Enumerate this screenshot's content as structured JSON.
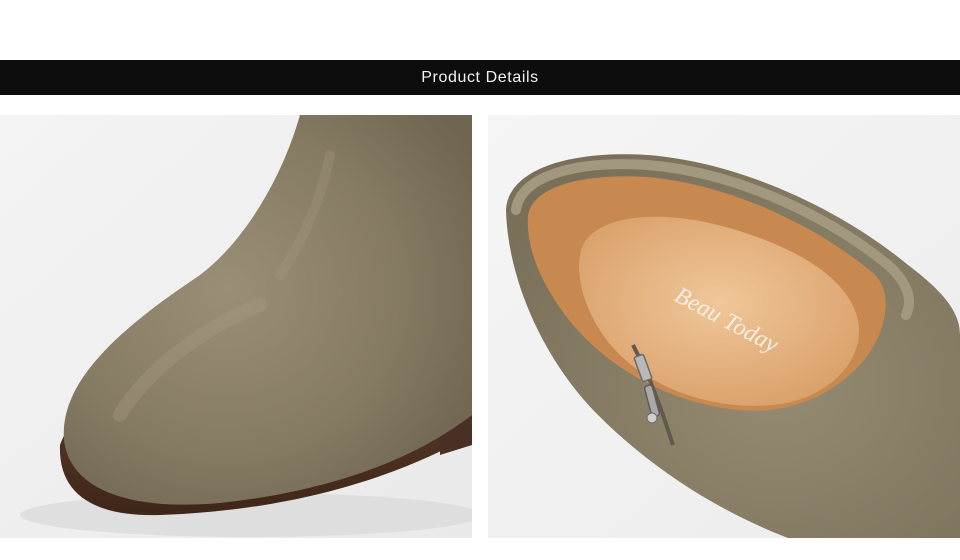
{
  "header": {
    "title": "Product Details"
  },
  "images": {
    "left": {
      "icon": "suede-boot-toe-closeup"
    },
    "right": {
      "icon": "suede-boot-opening-closeup",
      "insole_brand": "Beau Today"
    }
  },
  "colors": {
    "header_bg": "#0d0d0d",
    "header_text": "#f2f2f2",
    "suede": "#8c8168",
    "lining": "#c7894f",
    "insole": "#e8b98a",
    "sole_edge": "#5a3a2a"
  }
}
